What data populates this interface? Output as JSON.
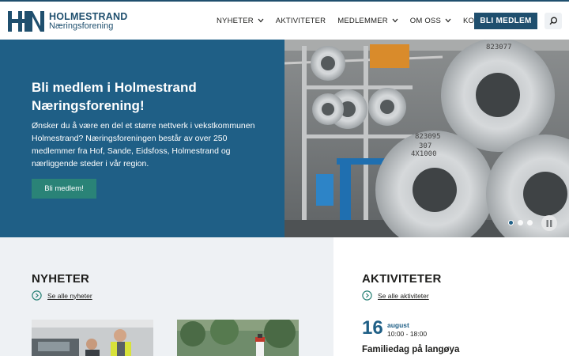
{
  "header": {
    "logo_mark": "HN",
    "logo_line1": "HOLMESTRAND",
    "logo_line2": "Næringsforening",
    "nav": [
      {
        "label": "NYHETER",
        "has_dropdown": true
      },
      {
        "label": "AKTIVITETER",
        "has_dropdown": false
      },
      {
        "label": "MEDLEMMER",
        "has_dropdown": true
      },
      {
        "label": "OM OSS",
        "has_dropdown": true
      },
      {
        "label": "KONTAKT",
        "has_dropdown": false
      }
    ],
    "cta_label": "BLI MEDLEM",
    "search_icon": "search-icon"
  },
  "hero": {
    "title": "Bli medlem i Holmestrand Næringsforening!",
    "text": "Ønsker du å være en del et større nettverk i vekstkommunen Holmestrand? Næringsforeningen består av over 250 medlemmer fra Hof, Sande, Eidsfoss, Holmestrand og nærliggende steder i vår region.",
    "button_label": "Bli medlem!",
    "slides_total": 3,
    "slide_active": 1,
    "coil_labels": [
      "823077",
      "823095",
      "4X1000",
      "307"
    ]
  },
  "news": {
    "title": "NYHETER",
    "see_all": "Se alle nyheter"
  },
  "activities": {
    "title": "AKTIVITETER",
    "see_all": "Se alle aktiviteter",
    "event": {
      "day": "16",
      "month": "august",
      "time": "10:00 - 18:00",
      "title": "Familiedag på langøya"
    }
  },
  "colors": {
    "brand": "#1f4f6e",
    "hero_panel": "#1f5f86",
    "button_teal": "#2a8377",
    "section_bg": "#eef1f4"
  }
}
